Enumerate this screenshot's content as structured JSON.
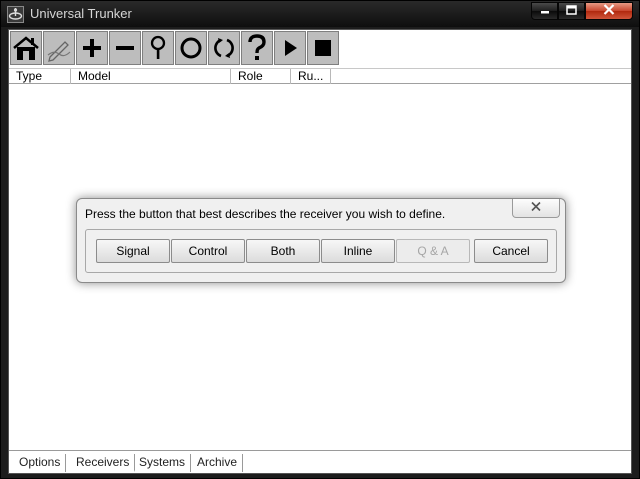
{
  "window": {
    "title": "Universal Trunker",
    "controls": {
      "minimize": "minimize-icon",
      "maximize": "maximize-icon",
      "close": "close-icon"
    }
  },
  "toolbar": {
    "tools": [
      {
        "name": "home-icon"
      },
      {
        "name": "edit-icon"
      },
      {
        "name": "plus-icon"
      },
      {
        "name": "minus-icon"
      },
      {
        "name": "magnifier-icon"
      },
      {
        "name": "circle-icon"
      },
      {
        "name": "refresh-icon"
      },
      {
        "name": "help-icon"
      },
      {
        "name": "play-icon"
      },
      {
        "name": "stop-icon"
      }
    ]
  },
  "list": {
    "columns": [
      "Type",
      "Model",
      "Role",
      "Ru..."
    ]
  },
  "tabs": {
    "items": [
      "Options",
      "Receivers",
      "Systems",
      "Archive"
    ],
    "active": "Receivers"
  },
  "dialog": {
    "message": "Press the button that best describes the receiver you wish to define.",
    "buttons": {
      "signal": "Signal",
      "control": "Control",
      "both": "Both",
      "inline": "Inline",
      "qa": "Q & A",
      "cancel": "Cancel"
    }
  }
}
